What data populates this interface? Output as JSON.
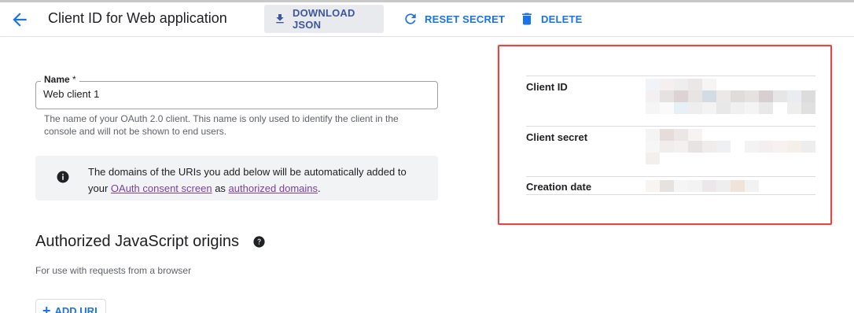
{
  "header": {
    "title": "Client ID for Web application",
    "download_label": "DOWNLOAD JSON",
    "reset_label": "RESET SECRET",
    "delete_label": "DELETE"
  },
  "name_field": {
    "label": "Name",
    "required_mark": "*",
    "value": "Web client 1",
    "hint": "The name of your OAuth 2.0 client. This name is only used to identify the client in the console and will not be shown to end users."
  },
  "banner": {
    "text_before": "The domains of the URIs you add below will be automatically added to your",
    "link1": "OAuth consent screen",
    "text_middle": "as",
    "link2": "authorized domains",
    "text_after": "."
  },
  "origins": {
    "title": "Authorized JavaScript origins",
    "subtitle": "For use with requests from a browser",
    "add_label": "ADD URI"
  },
  "client_info": {
    "rows": [
      {
        "key": "Client ID",
        "value_redacted": true
      },
      {
        "key": "Client secret",
        "value_redacted": true
      },
      {
        "key": "Creation date",
        "value_redacted": true
      }
    ]
  },
  "colors": {
    "accent": "#1a73e8",
    "highlight_border": "#e04848",
    "link": "#7b3fa7",
    "banner_bg": "#f1f3f4"
  }
}
